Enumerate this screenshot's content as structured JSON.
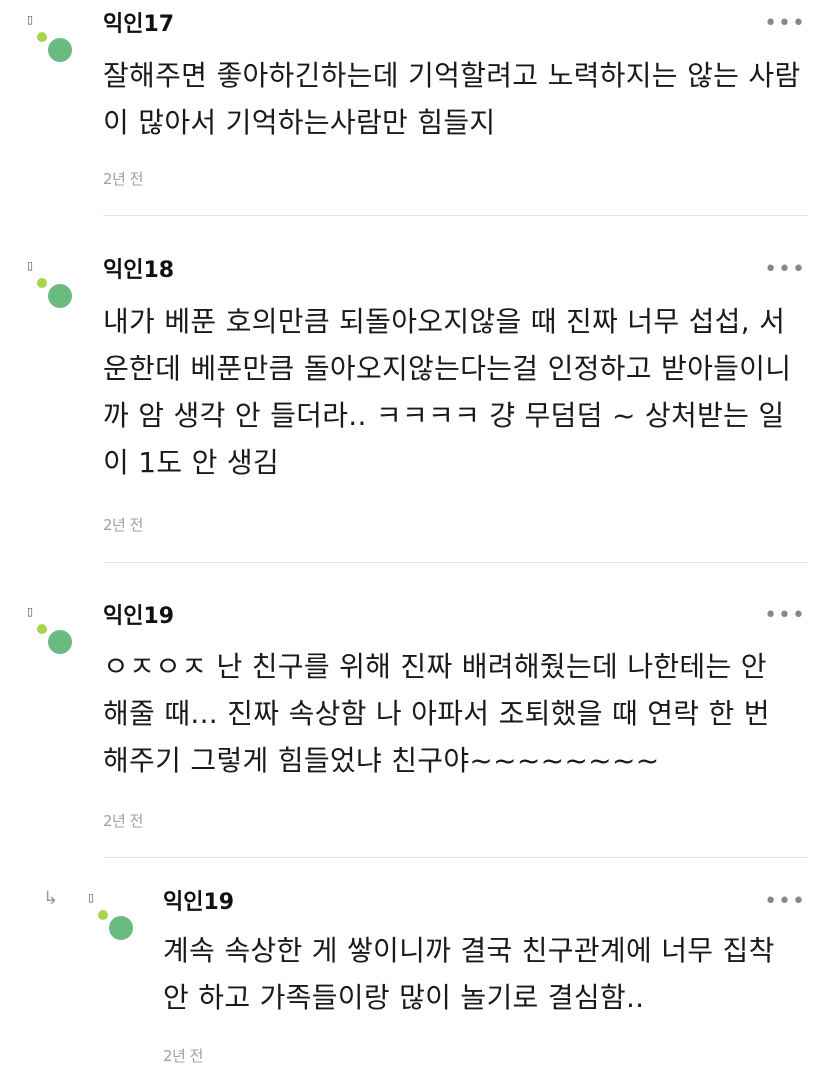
{
  "comments": [
    {
      "author": "익인17",
      "text": "잘해주면 좋아하긴하는데 기억할려고 노력하지는 않는 사람이 많아서 기억하는사람만 힘들지",
      "time": "2년 전"
    },
    {
      "author": "익인18",
      "text": "내가 베푼 호의만큼 되돌아오지않을 때 진짜 너무 섭섭, 서운한데 베푼만큼 돌아오지않는다는걸 인정하고 받아들이니까 암 생각 안 들더라.. ㅋㅋㅋㅋ 걍 무덤덤 ~ 상처받는 일이 1도 안 생김",
      "time": "2년 전"
    },
    {
      "author": "익인19",
      "text": "ㅇㅈㅇㅈ 난 친구를 위해 진짜 배려해줬는데 나한테는 안 해줄 때... 진짜 속상함 나 아파서 조퇴했을 때 연락 한 번 해주기 그렇게 힘들었냐 친구야~~~~~~~~",
      "time": "2년 전"
    },
    {
      "author": "익인19",
      "text": "계속 속상한 게 쌓이니까 결국 친구관계에 너무 집착 안 하고 가족들이랑 많이 놀기로 결심함..",
      "time": "2년 전"
    }
  ],
  "icons": {
    "more": "more-dots-icon",
    "reply": "reply-arrow-icon",
    "avatar_small_color": "#a6d64f",
    "avatar_big_color": "#6abb7f"
  }
}
